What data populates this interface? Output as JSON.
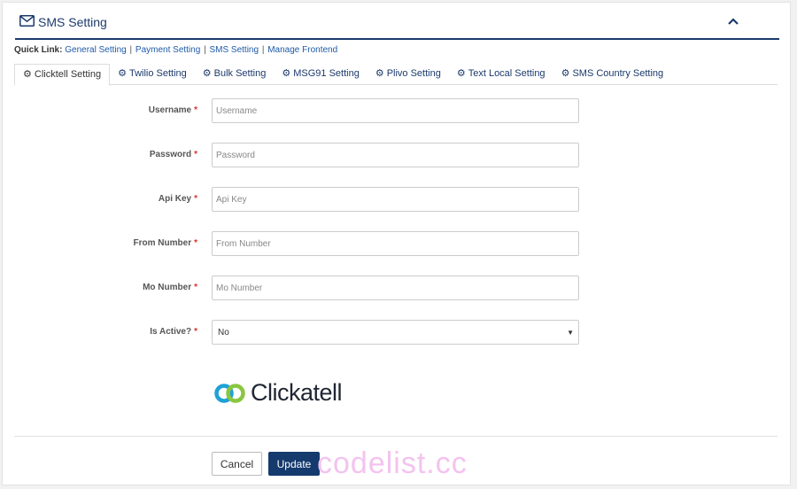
{
  "header": {
    "title": "SMS Setting"
  },
  "quick_links": {
    "label": "Quick Link:",
    "items": [
      "General Setting",
      "Payment Setting",
      "SMS Setting",
      "Manage Frontend"
    ],
    "separator": "|"
  },
  "tabs": [
    {
      "label": "Clicktell Setting",
      "active": true
    },
    {
      "label": "Twilio Setting"
    },
    {
      "label": "Bulk Setting"
    },
    {
      "label": "MSG91 Setting"
    },
    {
      "label": "Plivo Setting"
    },
    {
      "label": "Text Local Setting"
    },
    {
      "label": "SMS Country Setting"
    }
  ],
  "form": {
    "required_mark": "*",
    "username": {
      "label": "Username",
      "placeholder": "Username"
    },
    "password": {
      "label": "Password",
      "placeholder": "Password"
    },
    "api_key": {
      "label": "Api Key",
      "placeholder": "Api Key"
    },
    "from_number": {
      "label": "From Number",
      "placeholder": "From Number"
    },
    "mo_number": {
      "label": "Mo Number",
      "placeholder": "Mo Number"
    },
    "is_active": {
      "label": "Is Active?",
      "value": "No"
    }
  },
  "logo": {
    "text": "Clickatell"
  },
  "buttons": {
    "cancel": "Cancel",
    "update": "Update"
  },
  "watermark": "codelist.cc",
  "icons": {
    "header": "envelope-icon",
    "collapse": "chevron-up-icon",
    "tab": "gear-icon",
    "select": "caret-down-icon"
  },
  "colors": {
    "primary": "#1b3a6b",
    "link": "#1e5aa8",
    "required": "#d9302c",
    "logo_blue": "#1ea1d6",
    "logo_green": "#8ac640"
  }
}
